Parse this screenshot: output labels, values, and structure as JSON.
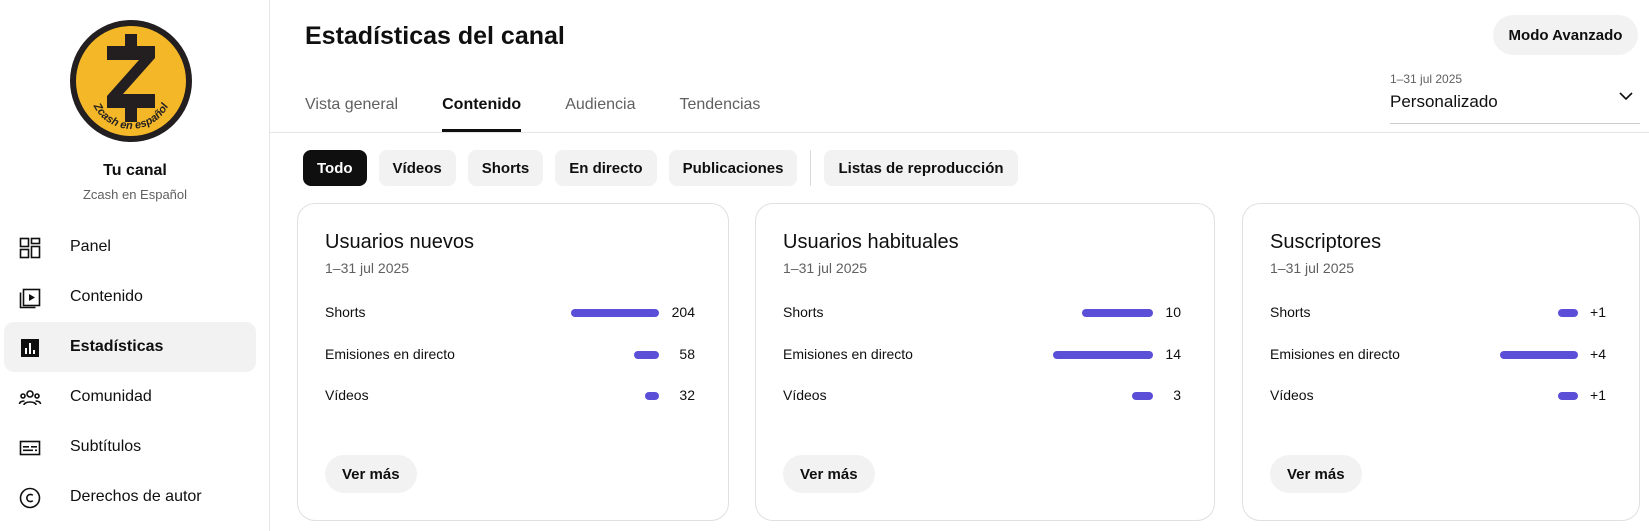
{
  "sidebar": {
    "channel_title": "Tu canal",
    "channel_name": "Zcash en Español",
    "logo_text": "Zcash en español",
    "items": [
      {
        "label": "Panel",
        "icon": "dashboard-icon"
      },
      {
        "label": "Contenido",
        "icon": "content-icon"
      },
      {
        "label": "Estadísticas",
        "icon": "analytics-icon",
        "active": true
      },
      {
        "label": "Comunidad",
        "icon": "community-icon"
      },
      {
        "label": "Subtítulos",
        "icon": "subtitles-icon"
      },
      {
        "label": "Derechos de autor",
        "icon": "copyright-icon"
      }
    ]
  },
  "header": {
    "title": "Estadísticas del canal",
    "advanced_mode": "Modo Avanzado",
    "tabs": [
      "Vista general",
      "Contenido",
      "Audiencia",
      "Tendencias"
    ],
    "active_tab": "Contenido",
    "date_range": "1–31 jul 2025",
    "date_selection": "Personalizado"
  },
  "filters": {
    "chips": [
      "Todo",
      "Vídeos",
      "Shorts",
      "En directo",
      "Publicaciones",
      "Listas de reproducción"
    ],
    "active": "Todo"
  },
  "cards": [
    {
      "title": "Usuarios nuevos",
      "date": "1–31 jul 2025",
      "rows": [
        {
          "label": "Shorts",
          "value": "204",
          "fraction": 1.0
        },
        {
          "label": "Emisiones en directo",
          "value": "58",
          "fraction": 0.284
        },
        {
          "label": "Vídeos",
          "value": "32",
          "fraction": 0.157
        }
      ],
      "button": "Ver más"
    },
    {
      "title": "Usuarios habituales",
      "date": "1–31 jul 2025",
      "rows": [
        {
          "label": "Shorts",
          "value": "10",
          "fraction": 0.714
        },
        {
          "label": "Emisiones en directo",
          "value": "14",
          "fraction": 1.0
        },
        {
          "label": "Vídeos",
          "value": "3",
          "fraction": 0.214
        }
      ],
      "button": "Ver más"
    },
    {
      "title": "Suscriptores",
      "date": "1–31 jul 2025",
      "rows": [
        {
          "label": "Shorts",
          "value": "+1",
          "fraction": 0.25
        },
        {
          "label": "Emisiones en directo",
          "value": "+4",
          "fraction": 1.0
        },
        {
          "label": "Vídeos",
          "value": "+1",
          "fraction": 0.25
        }
      ],
      "button": "Ver más"
    }
  ],
  "colors": {
    "bar": "#5b4fd8",
    "logo_gold": "#f4b728",
    "active_chip": "#0f0f0f"
  }
}
